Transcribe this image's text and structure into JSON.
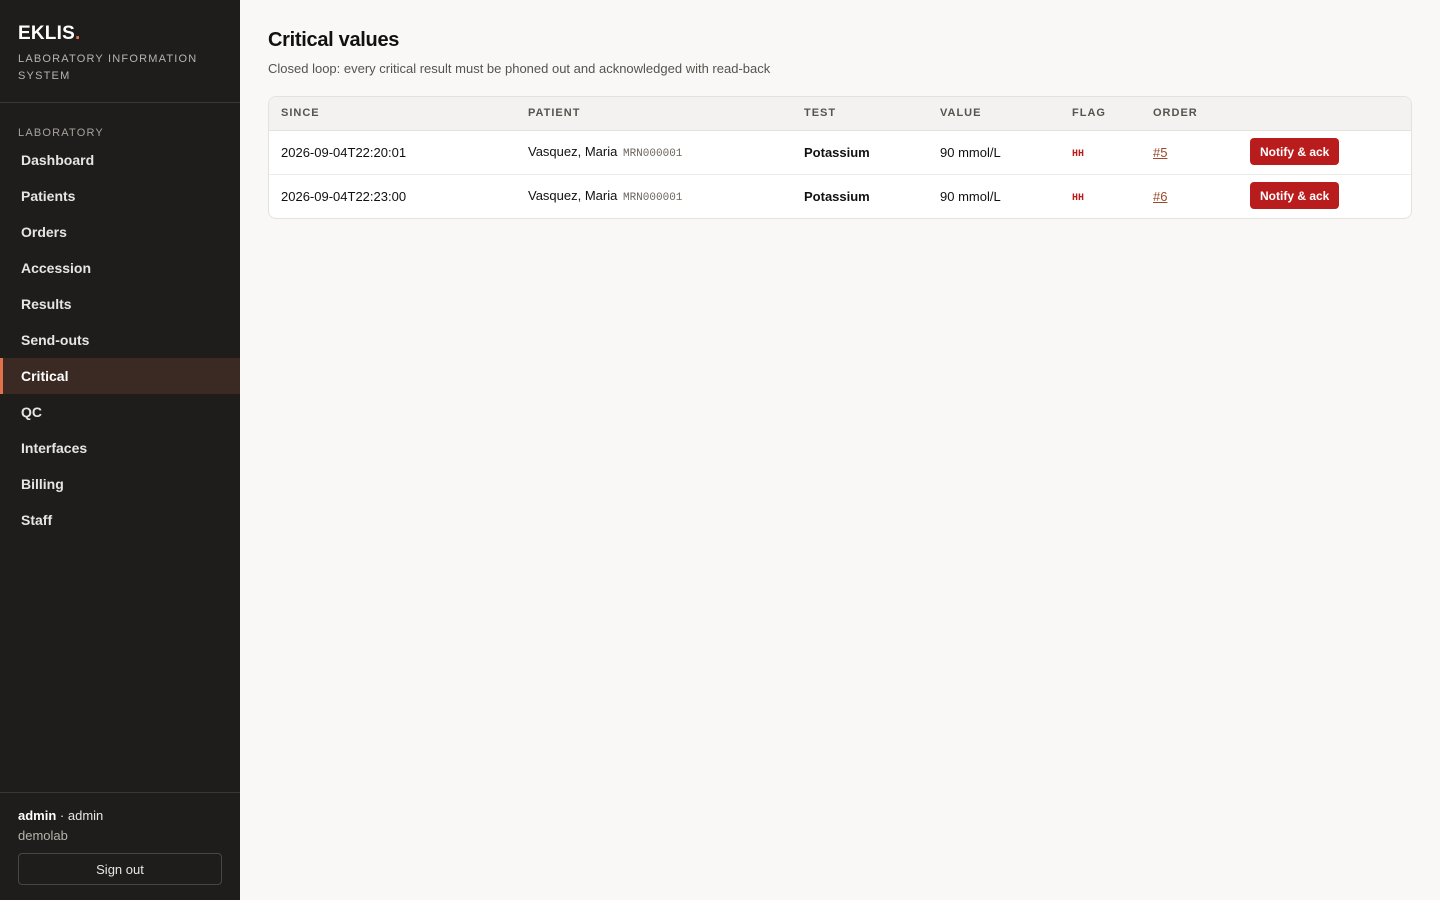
{
  "brand": {
    "name": "EKLIS",
    "dot": ".",
    "subtitle": "Laboratory Information System"
  },
  "sidebar": {
    "section_label": "Laboratory",
    "items": [
      {
        "label": "Dashboard",
        "active": false
      },
      {
        "label": "Patients",
        "active": false
      },
      {
        "label": "Orders",
        "active": false
      },
      {
        "label": "Accession",
        "active": false
      },
      {
        "label": "Results",
        "active": false
      },
      {
        "label": "Send-outs",
        "active": false
      },
      {
        "label": "Critical",
        "active": true
      },
      {
        "label": "QC",
        "active": false
      },
      {
        "label": "Interfaces",
        "active": false
      },
      {
        "label": "Billing",
        "active": false
      },
      {
        "label": "Staff",
        "active": false
      }
    ],
    "footer": {
      "username": "admin",
      "separator": " · ",
      "role": "admin",
      "org": "demolab",
      "signout_label": "Sign out"
    }
  },
  "page": {
    "title": "Critical values",
    "subtitle": "Closed loop: every critical result must be phoned out and acknowledged with read-back"
  },
  "table": {
    "columns": [
      "Since",
      "Patient",
      "Test",
      "Value",
      "Flag",
      "Order",
      ""
    ],
    "rows": [
      {
        "since": "2026-09-04T22:20:01",
        "patient_name": "Vasquez, Maria",
        "mrn": "MRN000001",
        "test": "Potassium",
        "value": "90 mmol/L",
        "flag": "HH",
        "order": "#5",
        "action_label": "Notify & ack"
      },
      {
        "since": "2026-09-04T22:23:00",
        "patient_name": "Vasquez, Maria",
        "mrn": "MRN000001",
        "test": "Potassium",
        "value": "90 mmol/L",
        "flag": "HH",
        "order": "#6",
        "action_label": "Notify & ack"
      }
    ]
  },
  "colors": {
    "sidebar_bg": "#1f1d1b",
    "accent": "#e0714a",
    "critical_red": "#b91c1c",
    "link": "#9a4a2a"
  }
}
